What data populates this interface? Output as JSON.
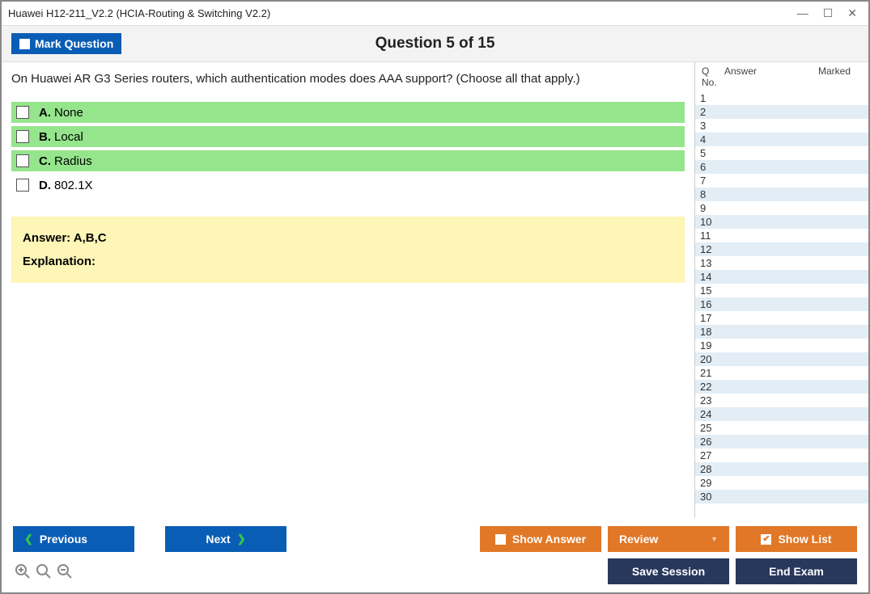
{
  "window": {
    "title": "Huawei H12-211_V2.2 (HCIA-Routing & Switching V2.2)"
  },
  "header": {
    "mark_label": "Mark Question",
    "question_title": "Question 5 of 15"
  },
  "question": {
    "text": "On Huawei AR G3 Series routers, which authentication modes does AAA support? (Choose all that apply.)",
    "options": [
      {
        "letter": "A.",
        "text": "None",
        "correct": true
      },
      {
        "letter": "B.",
        "text": "Local",
        "correct": true
      },
      {
        "letter": "C.",
        "text": "Radius",
        "correct": true
      },
      {
        "letter": "D.",
        "text": "802.1X",
        "correct": false
      }
    ],
    "answer_label": "Answer: A,B,C",
    "explanation_label": "Explanation:"
  },
  "sidepanel": {
    "columns": {
      "qno": "Q No.",
      "answer": "Answer",
      "marked": "Marked"
    },
    "rows": 30
  },
  "footer": {
    "previous": "Previous",
    "next": "Next",
    "show_answer": "Show Answer",
    "review": "Review",
    "show_list": "Show List",
    "save_session": "Save Session",
    "end_exam": "End Exam"
  }
}
